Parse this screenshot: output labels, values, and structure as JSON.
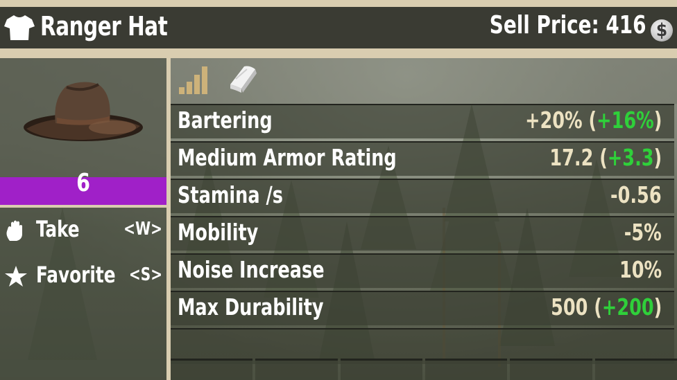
{
  "header": {
    "item_name": "Ranger Hat",
    "sell_price_label": "Sell Price: 416",
    "currency_icon": "dukes-coin-icon",
    "currency_glyph": "$"
  },
  "item": {
    "quantity": "6",
    "quality_color": "#a020c8",
    "image_icon": "ranger-hat-icon"
  },
  "actions": [
    {
      "label": "Take",
      "key": "<W>",
      "icon": "hand-icon"
    },
    {
      "label": "Favorite",
      "key": "<S>",
      "icon": "star-icon"
    }
  ],
  "info_icons": [
    "quality-bars-icon",
    "book-icon"
  ],
  "stats": [
    {
      "name": "Bartering",
      "value": "+20% (",
      "bonus": "+16%",
      "suffix": ")"
    },
    {
      "name": "Medium Armor Rating",
      "value": "17.2 (",
      "bonus": "+3.3",
      "suffix": ")"
    },
    {
      "name": "Stamina /s",
      "value": "-0.56",
      "bonus": "",
      "suffix": ""
    },
    {
      "name": "Mobility",
      "value": "-5%",
      "bonus": "",
      "suffix": ""
    },
    {
      "name": "Noise Increase",
      "value": "10%",
      "bonus": "",
      "suffix": ""
    },
    {
      "name": "Max Durability",
      "value": "500 (",
      "bonus": "+200",
      "suffix": ")"
    }
  ],
  "colors": {
    "frame": "#d9cdb0",
    "header_bg": "#3a3b33",
    "bonus_green": "#2fd03a",
    "value_text": "#ece2c2"
  }
}
